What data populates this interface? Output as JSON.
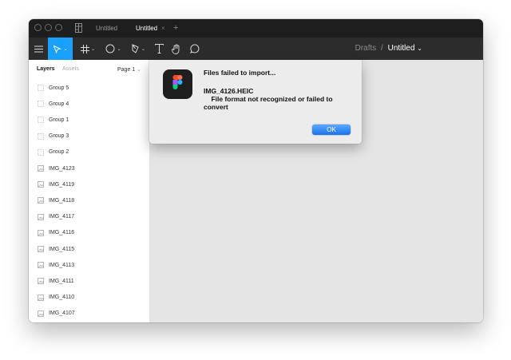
{
  "tabs": [
    {
      "label": "Untitled",
      "active": false
    },
    {
      "label": "Untitled",
      "active": true
    }
  ],
  "tab_close_glyph": "×",
  "tab_add_glyph": "+",
  "toolbar": {
    "tools": [
      "menu-icon",
      "move-icon",
      "frame-icon",
      "shape-icon",
      "pen-icon",
      "text-icon",
      "hand-icon",
      "comment-icon"
    ],
    "accent": "#18a0fb"
  },
  "breadcrumb": {
    "parent": "Drafts",
    "separator": "/",
    "current": "Untitled",
    "caret": "⌄"
  },
  "sidebar": {
    "tab_layers": "Layers",
    "tab_assets": "Assets",
    "page_selector": "Page 1",
    "page_caret": "⌄",
    "items": [
      {
        "label": "Group 5",
        "icon": "group-icon"
      },
      {
        "label": "Group 4",
        "icon": "group-icon"
      },
      {
        "label": "Group 1",
        "icon": "group-icon"
      },
      {
        "label": "Group 3",
        "icon": "group-icon"
      },
      {
        "label": "Group 2",
        "icon": "group-icon"
      },
      {
        "label": "IMG_4123",
        "icon": "image-icon"
      },
      {
        "label": "IMG_4119",
        "icon": "image-icon"
      },
      {
        "label": "IMG_4118",
        "icon": "image-icon"
      },
      {
        "label": "IMG_4117",
        "icon": "image-icon"
      },
      {
        "label": "IMG_4116",
        "icon": "image-icon"
      },
      {
        "label": "IMG_4115",
        "icon": "image-icon"
      },
      {
        "label": "IMG_4113",
        "icon": "image-icon"
      },
      {
        "label": "IMG_4111",
        "icon": "image-icon"
      },
      {
        "label": "IMG_4110",
        "icon": "image-icon"
      },
      {
        "label": "IMG_4107",
        "icon": "image-icon"
      }
    ]
  },
  "dialog": {
    "title": "Files failed to import...",
    "message": "IMG_4126.HEIC\n    File format not recognized or failed to\nconvert",
    "ok_label": "OK"
  }
}
